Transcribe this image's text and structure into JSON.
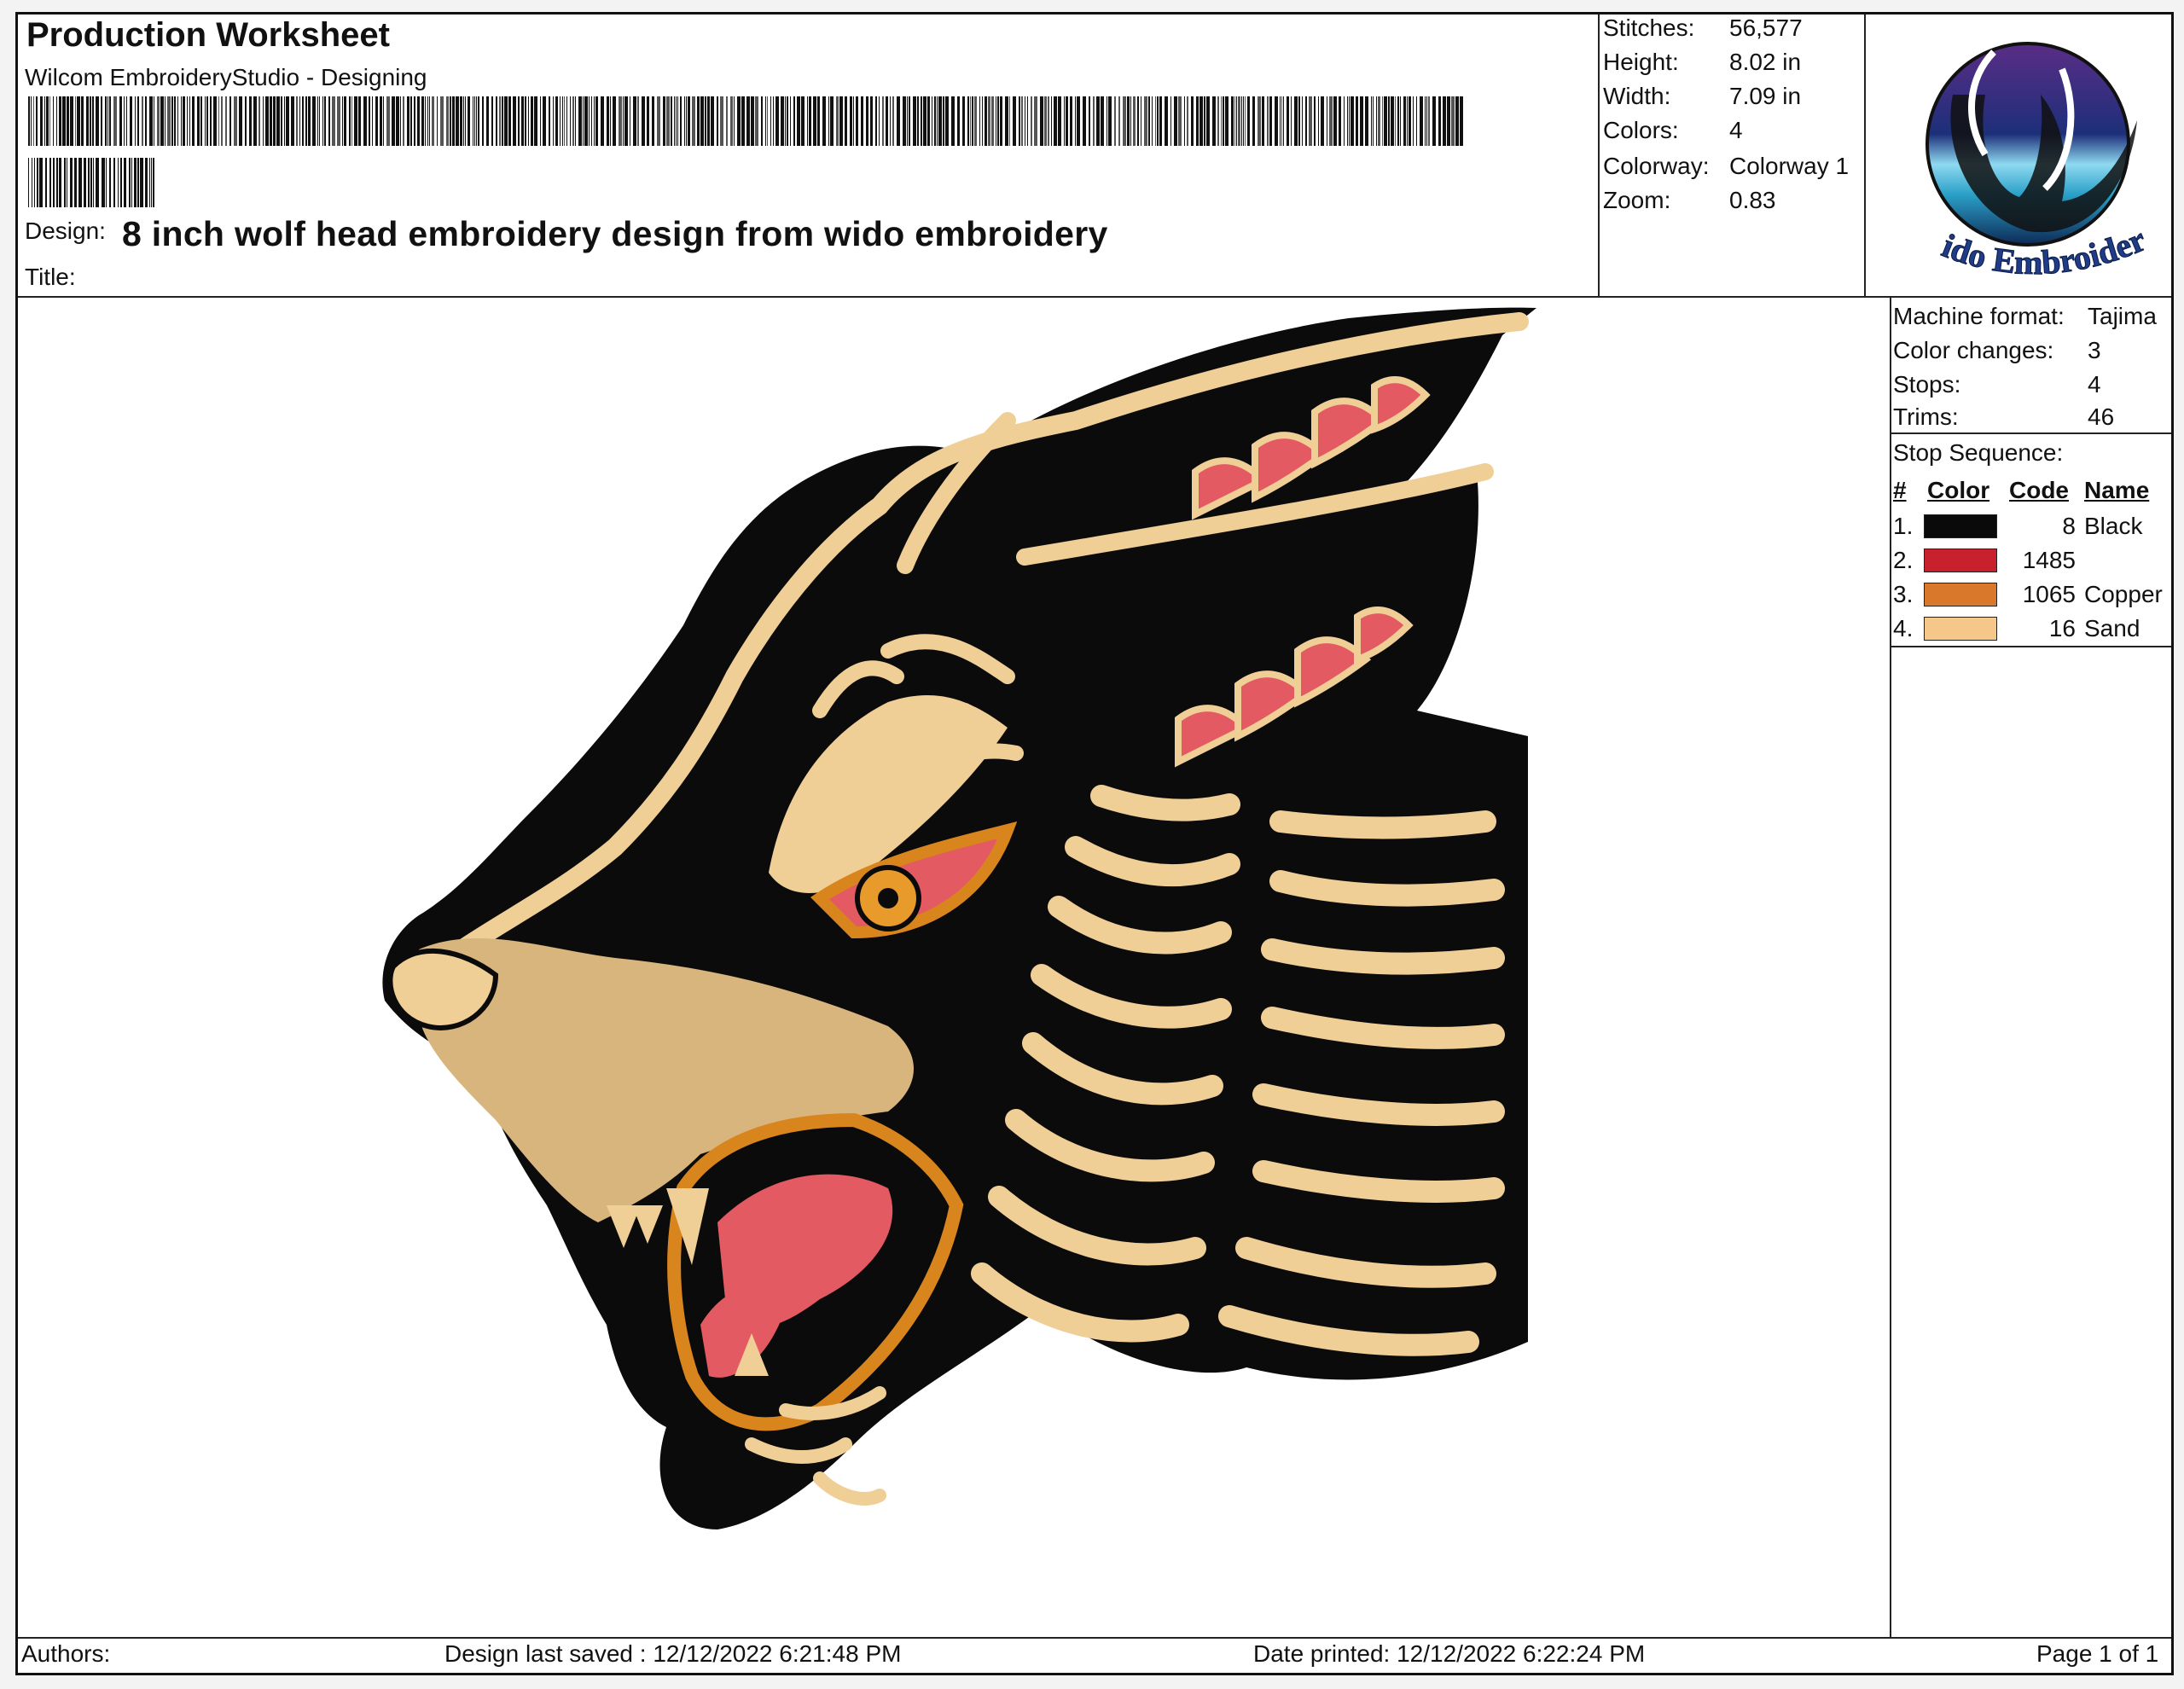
{
  "header": {
    "title": "Production Worksheet",
    "software": "Wilcom EmbroideryStudio - Designing",
    "design_label": "Design:",
    "design_name": "8 inch wolf head embroidery design from wido embroidery",
    "title_label": "Title:"
  },
  "stats": [
    {
      "label": "Stitches:",
      "value": "56,577"
    },
    {
      "label": "Height:",
      "value": "8.02 in"
    },
    {
      "label": "Width:",
      "value": "7.09 in"
    },
    {
      "label": "Colors:",
      "value": "4"
    },
    {
      "label": "Colorway:",
      "value": "Colorway 1"
    },
    {
      "label": "Zoom:",
      "value": "0.83"
    }
  ],
  "logo": {
    "text": "Wido Embroidery",
    "icon": "wido-w-logo-icon"
  },
  "machine": [
    {
      "label": "Machine format:",
      "value": "Tajima"
    },
    {
      "label": "Color changes:",
      "value": "3"
    },
    {
      "label": "Stops:",
      "value": "4"
    },
    {
      "label": "Trims:",
      "value": "46"
    }
  ],
  "stop_sequence": {
    "label": "Stop Sequence:",
    "headers": {
      "num": "#",
      "color": "Color",
      "code": "Code",
      "name": "Name"
    },
    "rows": [
      {
        "num": "1.",
        "color": "#0a0a0a",
        "code": "8",
        "name": "Black"
      },
      {
        "num": "2.",
        "color": "#c8202c",
        "code": "1485",
        "name": ""
      },
      {
        "num": "3.",
        "color": "#d9772a",
        "code": "1065",
        "name": "Copper"
      },
      {
        "num": "4.",
        "color": "#f5c88a",
        "code": "16",
        "name": "Sand"
      }
    ]
  },
  "artwork": {
    "subject": "wolf-head-embroidery"
  },
  "footer": {
    "authors": "Authors:",
    "saved": "Design last saved : 12/12/2022 6:21:48 PM",
    "printed": "Date printed: 12/12/2022 6:22:24 PM",
    "page": "Page 1 of 1"
  }
}
